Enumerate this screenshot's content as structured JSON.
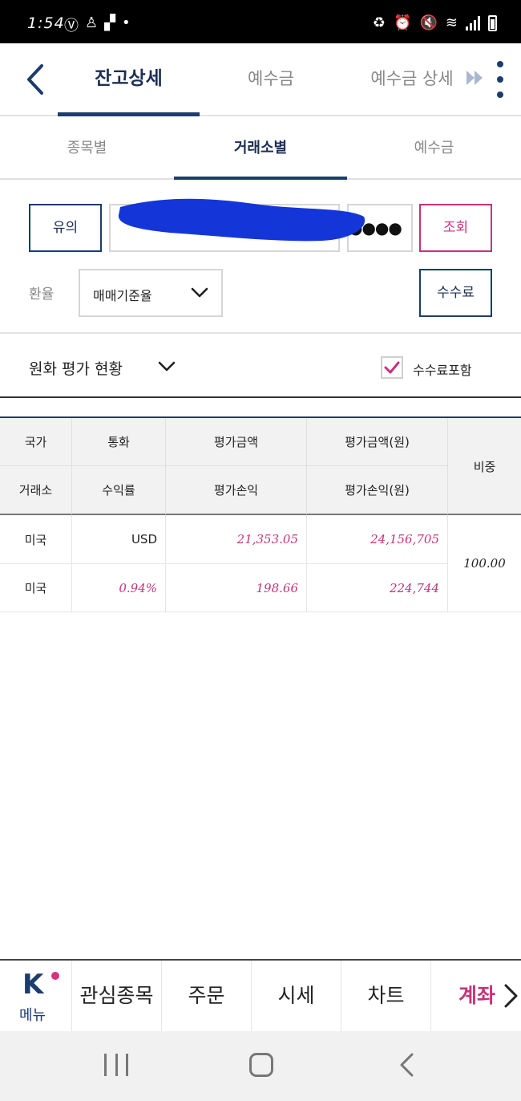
{
  "status_bar": {
    "time": "1:54"
  },
  "header": {
    "tabs": [
      {
        "label": "잔고상세"
      },
      {
        "label": "예수금"
      },
      {
        "label": "예수금 상세"
      }
    ]
  },
  "sub_tabs": [
    {
      "label": "종목별"
    },
    {
      "label": "거래소별"
    },
    {
      "label": "예수금"
    }
  ],
  "form": {
    "notice_button": "유의",
    "password_masked": "●●●●",
    "query_button": "조회",
    "rate_label": "환율",
    "rate_select_value": "매매기준율",
    "fee_button": "수수료"
  },
  "eval_section": {
    "title": "원화 평가 현황",
    "fee_include_label": "수수료포함",
    "fee_include_checked": true
  },
  "table": {
    "header_row1": [
      "국가",
      "통화",
      "평가금액",
      "평가금액(원)"
    ],
    "header_row2": [
      "거래소",
      "수익률",
      "평가손익",
      "평가손익(원)"
    ],
    "header_weight": "비중",
    "row1": {
      "country": "미국",
      "currency": "USD",
      "eval_amount": "21,353.05",
      "eval_amount_krw": "24,156,705"
    },
    "row2": {
      "exchange": "미국",
      "return_rate": "0.94%",
      "eval_pl": "198.66",
      "eval_pl_krw": "224,744"
    },
    "weight": "100.00"
  },
  "bottom_nav": {
    "menu_label": "메뉴",
    "logo_letter": "K",
    "items": [
      {
        "label": "관심종목"
      },
      {
        "label": "주문"
      },
      {
        "label": "시세"
      },
      {
        "label": "차트"
      },
      {
        "label": "계좌"
      }
    ]
  },
  "colors": {
    "navy": "#1c3c6e",
    "accent_pink": "#c8327a",
    "redaction_blue": "#1436d8"
  }
}
